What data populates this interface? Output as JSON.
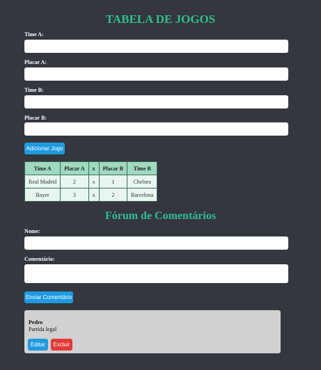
{
  "games": {
    "title": "TABELA DE JOGOS",
    "fields": {
      "team_a": {
        "label": "Time A:",
        "value": ""
      },
      "score_a": {
        "label": "Placar A:",
        "value": ""
      },
      "team_b": {
        "label": "Time B:",
        "value": ""
      },
      "score_b": {
        "label": "Placar B:",
        "value": ""
      }
    },
    "add_button": "Adicionar Jogo",
    "table": {
      "headers": [
        "Time A",
        "Placar A",
        "x",
        "Placar B",
        "Time B"
      ],
      "rows": [
        [
          "Real Madrid",
          "2",
          "x",
          "1",
          "Chelsea"
        ],
        [
          "Bayer",
          "3",
          "x",
          "2",
          "Barcelona"
        ]
      ]
    }
  },
  "forum": {
    "title": "Fórum de Comentários",
    "name_label": "Nome:",
    "comment_label": "Comentário:",
    "submit_button": "Enviar Comentário",
    "comments": [
      {
        "author": "Pedro",
        "text": "Partida legal",
        "edit_label": "Editar",
        "delete_label": "Excluir"
      }
    ]
  },
  "colors": {
    "background": "#34373d",
    "title": "#2fbf8f",
    "primary_button": "#1e9be0",
    "danger_button": "#e53935",
    "table_header": "#9ed9c0",
    "table_cell": "#e8f6f2",
    "comment_card": "#d1d1d1"
  }
}
